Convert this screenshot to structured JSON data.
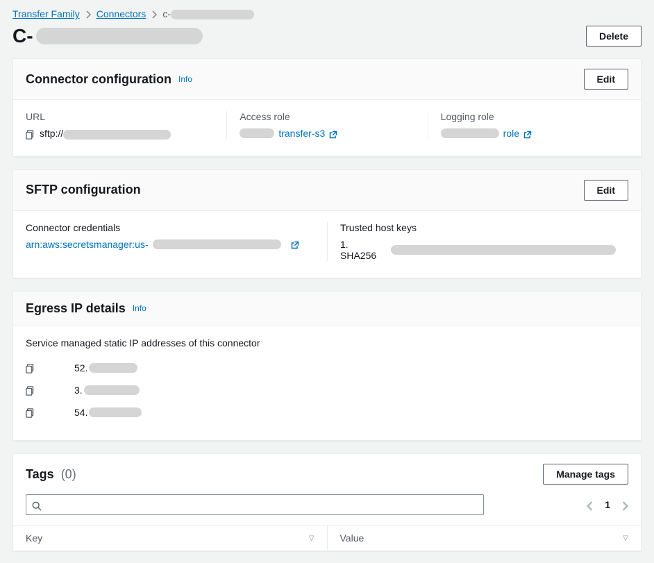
{
  "breadcrumb": {
    "service": "Transfer Family",
    "connectors": "Connectors",
    "current_prefix": "c-"
  },
  "title_prefix": "C-",
  "buttons": {
    "delete": "Delete",
    "edit": "Edit",
    "manage_tags": "Manage tags"
  },
  "labels": {
    "info": "Info"
  },
  "connector_config": {
    "heading": "Connector configuration",
    "url_label": "URL",
    "url_prefix": "sftp://",
    "access_role_label": "Access role",
    "access_role_link": "transfer-s3",
    "logging_role_label": "Logging role",
    "logging_role_link": "role"
  },
  "sftp_config": {
    "heading": "SFTP configuration",
    "credentials_label": "Connector credentials",
    "credentials_prefix": "arn:aws:secretsmanager:us-",
    "hostkeys_label": "Trusted host keys",
    "hostkey_prefix": "1. SHA256"
  },
  "egress": {
    "heading": "Egress IP details",
    "description": "Service managed static IP addresses of this connector",
    "ips": [
      "52.",
      "3.",
      "54."
    ]
  },
  "tags": {
    "heading": "Tags",
    "count": "(0)",
    "page": "1",
    "key_label": "Key",
    "value_label": "Value",
    "search_placeholder": ""
  }
}
